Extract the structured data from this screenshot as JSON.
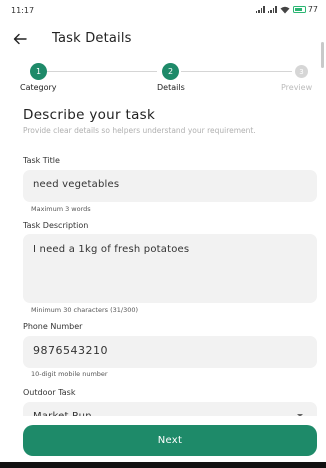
{
  "status": {
    "time": "11:17",
    "battery": "77"
  },
  "header": {
    "title": "Task Details"
  },
  "stepper": {
    "steps": [
      {
        "number": "1",
        "label": "Category",
        "state": "done"
      },
      {
        "number": "2",
        "label": "Details",
        "state": "active"
      },
      {
        "number": "3",
        "label": "Preview",
        "state": "pending"
      }
    ]
  },
  "section": {
    "title": "Describe your task",
    "description": "Provide clear details so helpers understand your requirement."
  },
  "fields": {
    "task_title": {
      "label": "Task Title",
      "value": "need vegetables",
      "helper": "Maximum 3 words"
    },
    "task_description": {
      "label": "Task Description",
      "value": "I need a 1kg of  fresh potatoes",
      "helper": "Minimum 30 characters (31/300)"
    },
    "phone": {
      "label": "Phone Number",
      "value": "9876543210",
      "helper": "10-digit mobile number"
    },
    "outdoor_task": {
      "label": "Outdoor Task",
      "value": "Market Run"
    }
  },
  "footer": {
    "next_label": "Next"
  },
  "colors": {
    "accent": "#1e8a69",
    "input_bg": "#f2f2f2"
  }
}
